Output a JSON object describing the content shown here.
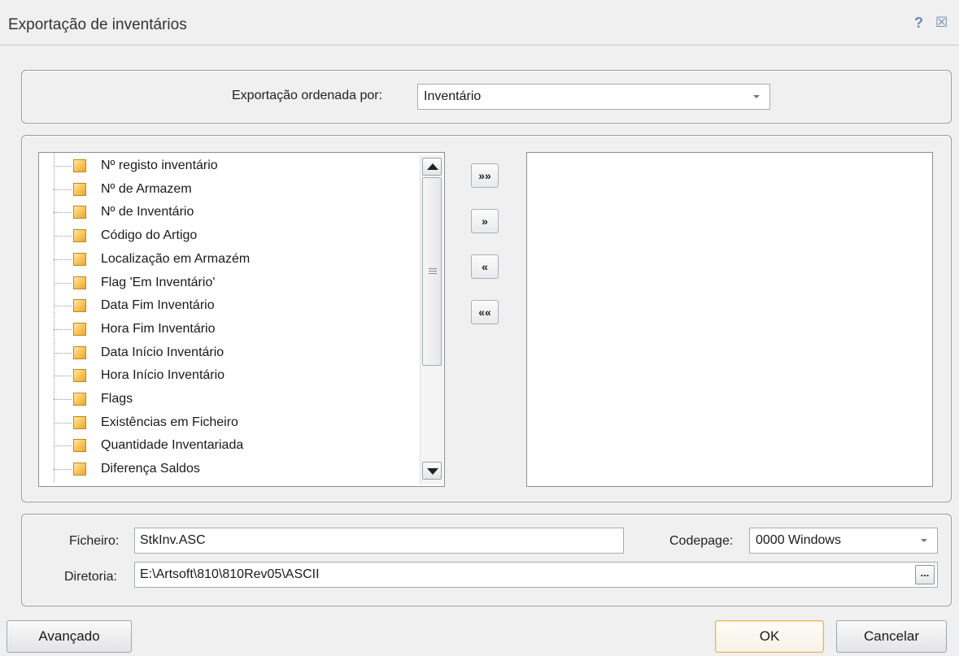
{
  "window": {
    "title": "Exportação de inventários",
    "help_glyph": "?",
    "close_glyph": "☒"
  },
  "sort": {
    "label": "Exportação ordenada por:",
    "value": "Inventário"
  },
  "fields": {
    "items": [
      "Nº registo inventário",
      "Nº de Armazem",
      "Nº de Inventário",
      "Código do Artigo",
      "Localização em Armazém",
      "Flag 'Em Inventário'",
      "Data Fim Inventário",
      "Hora Fim Inventário",
      "Data Início Inventário",
      "Hora Início Inventário",
      "Flags",
      "Existências em Ficheiro",
      "Quantidade Inventariada",
      "Diferença Saldos"
    ],
    "selected": []
  },
  "move_buttons": {
    "add_all": "»»",
    "add": "»",
    "remove": "«",
    "remove_all": "««"
  },
  "file": {
    "file_label": "Ficheiro:",
    "file_value": "StkInv.ASC",
    "codepage_label": "Codepage:",
    "codepage_value": "0000 Windows",
    "dir_label": "Diretoria:",
    "dir_value": "E:\\Artsoft\\810\\810Rev05\\ASCII",
    "browse_label": "..."
  },
  "buttons": {
    "advanced": "Avançado",
    "ok": "OK",
    "cancel": "Cancelar"
  }
}
